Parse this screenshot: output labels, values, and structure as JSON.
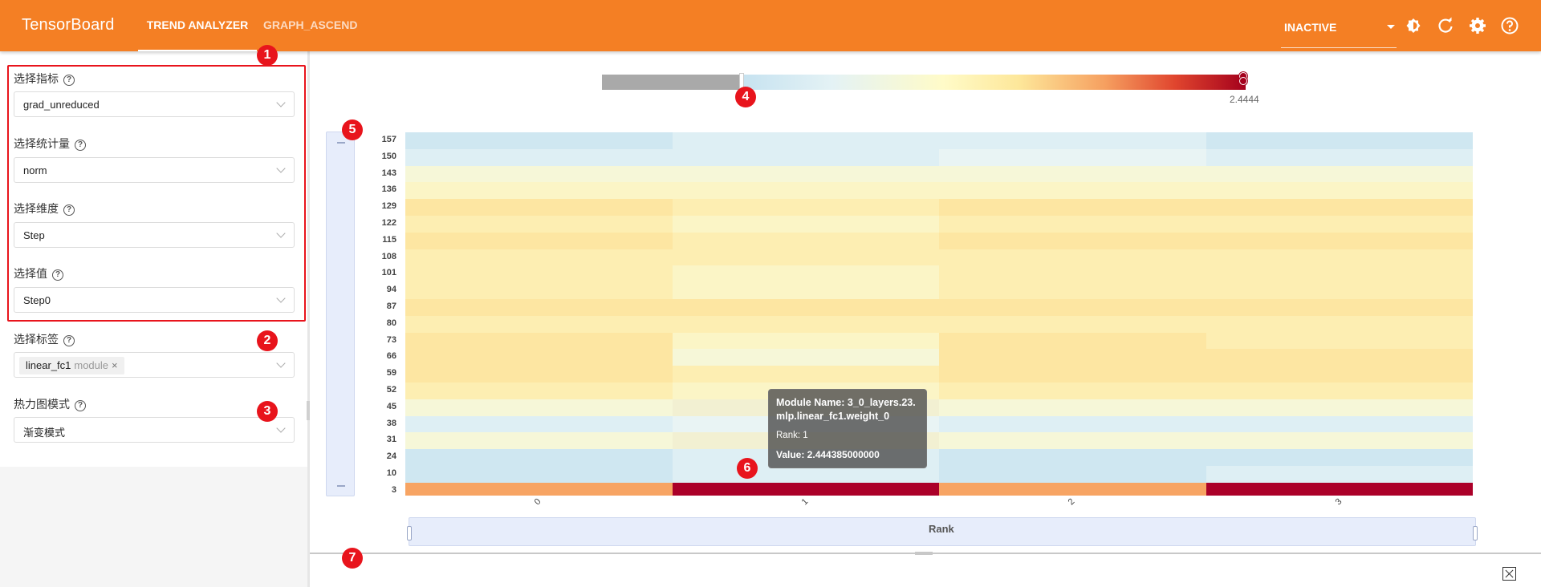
{
  "header": {
    "brand": "TensorBoard",
    "tabs": [
      {
        "label": "TREND ANALYZER",
        "active": true
      },
      {
        "label": "GRAPH_ASCEND",
        "active": false
      }
    ],
    "run_select": {
      "value": "INACTIVE"
    },
    "icons": [
      "theme-icon",
      "refresh-icon",
      "settings-icon",
      "help-icon"
    ],
    "color": "#f47f24"
  },
  "sidebar": {
    "metric": {
      "label": "选择指标",
      "value": "grad_unreduced"
    },
    "statistic": {
      "label": "选择统计量",
      "value": "norm"
    },
    "dimension": {
      "label": "选择维度",
      "value": "Step"
    },
    "dim_value": {
      "label": "选择值",
      "value": "Step0"
    },
    "tag": {
      "label": "选择标签",
      "chip": "linear_fc1",
      "chip_sub": "module",
      "chip_remove": "×"
    },
    "heatmap_mode": {
      "label": "热力图模式",
      "value": "渐变模式"
    }
  },
  "badges": [
    "1",
    "2",
    "3",
    "4",
    "5",
    "6",
    "7"
  ],
  "colorbar": {
    "max_label": "2.4444"
  },
  "tooltip": {
    "module_name": "Module Name: 3_0_layers.23. mlp.linear_fc1.weight_0",
    "rank": "Rank: 1",
    "value": "Value: 2.444385000000"
  },
  "chart_data": {
    "type": "heatmap",
    "xlabel": "Rank",
    "x_categories": [
      "0",
      "1",
      "2",
      "3"
    ],
    "y_tick_labels": [
      "157",
      "150",
      "143",
      "136",
      "129",
      "122",
      "115",
      "108",
      "101",
      "94",
      "87",
      "80",
      "73",
      "66",
      "59",
      "52",
      "45",
      "38",
      "31",
      "24",
      "10",
      "3"
    ],
    "value_max": 2.4444,
    "highlighted_cell": {
      "rank": 1,
      "value": 2.444385
    }
  }
}
